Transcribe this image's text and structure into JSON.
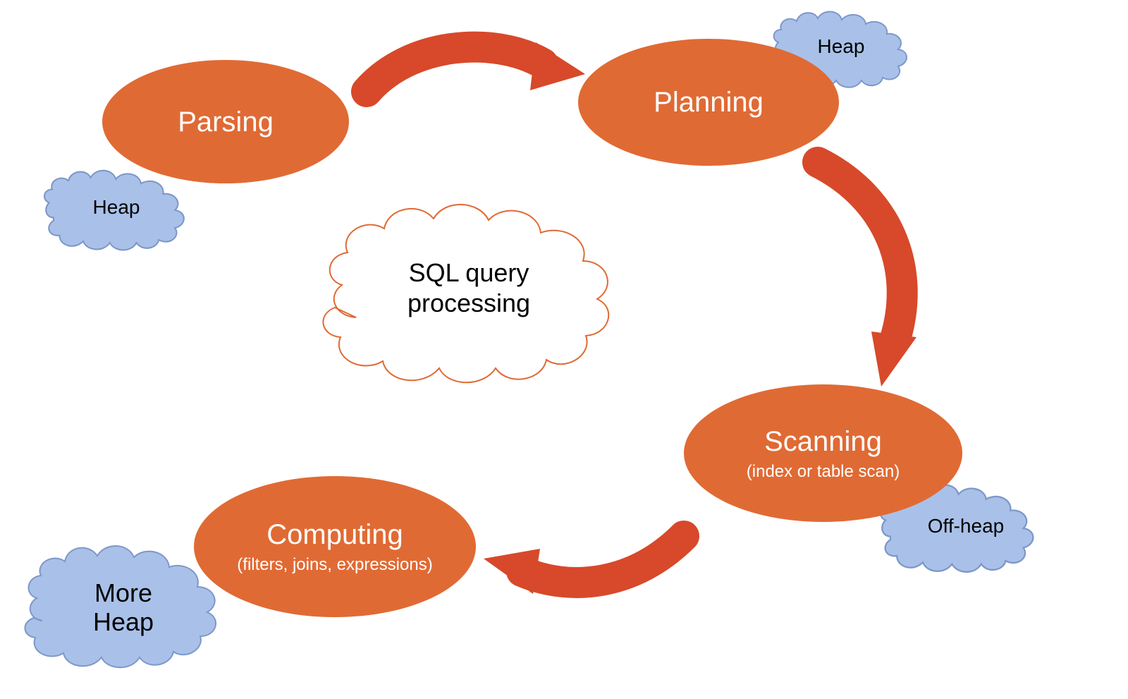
{
  "center": {
    "line1": "SQL query",
    "line2": "processing"
  },
  "stages": {
    "parsing": {
      "title": "Parsing",
      "sub": ""
    },
    "planning": {
      "title": "Planning",
      "sub": ""
    },
    "scanning": {
      "title": "Scanning",
      "sub": "(index or table scan)"
    },
    "computing": {
      "title": "Computing",
      "sub": "(filters, joins, expressions)"
    }
  },
  "clouds": {
    "parsing_heap": "Heap",
    "planning_heap": "Heap",
    "scanning_heap": "Off-heap",
    "computing_heap1": "More",
    "computing_heap2": "Heap"
  },
  "colors": {
    "ellipse_fill": "#e06a34",
    "arrow_fill": "#d7492a",
    "cloud_fill": "#a9c1e8",
    "cloud_stroke": "#7e97c9",
    "center_stroke": "#e06a34"
  },
  "flow": [
    "parsing",
    "planning",
    "scanning",
    "computing"
  ]
}
